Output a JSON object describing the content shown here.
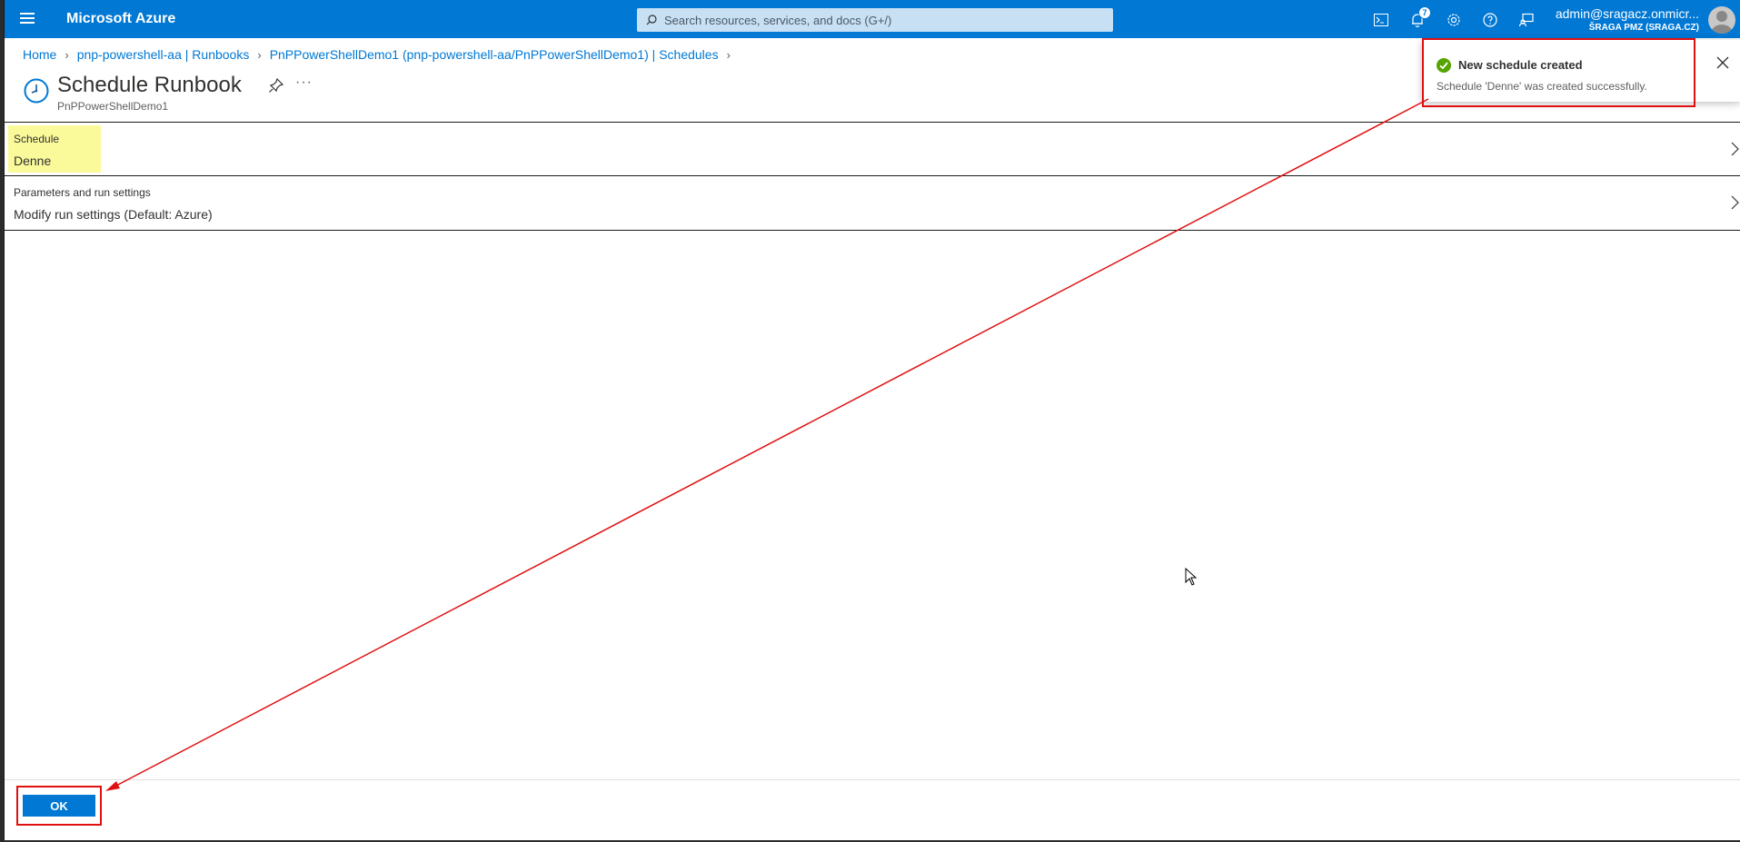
{
  "topbar": {
    "brand": "Microsoft Azure",
    "search_placeholder": "Search resources, services, and docs (G+/)",
    "notification_count": "7",
    "account_email": "admin@sragacz.onmicr...",
    "account_tenant": "ŠRAGA PMZ (SRAGA.CZ)",
    "icons": [
      "cloud-shell-icon",
      "notifications-icon",
      "settings-icon",
      "help-icon",
      "feedback-icon"
    ]
  },
  "breadcrumb": {
    "items": [
      "Home",
      "pnp-powershell-aa | Runbooks",
      "PnPPowerShellDemo1 (pnp-powershell-aa/PnPPowerShellDemo1) | Schedules"
    ]
  },
  "header": {
    "title": "Schedule Runbook",
    "subtitle": "PnPPowerShellDemo1"
  },
  "rows": [
    {
      "label": "Schedule",
      "value": "Denne"
    },
    {
      "label": "Parameters and run settings",
      "value": "Modify run settings (Default: Azure)"
    }
  ],
  "footer": {
    "ok_label": "OK"
  },
  "toast": {
    "title": "New schedule created",
    "message": "Schedule 'Denne' was created successfully."
  },
  "colors": {
    "accent": "#0078d4",
    "highlight": "#fbfa9b",
    "annotation": "#e01010",
    "success": "#57a300"
  }
}
